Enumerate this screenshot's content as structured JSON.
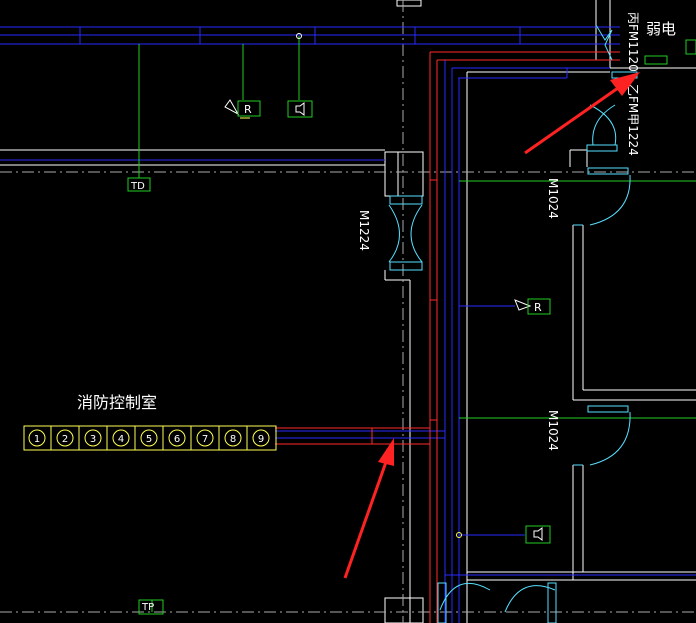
{
  "colors": {
    "background": "#000000",
    "wall": "#FFFFFF",
    "blue_pipe": "#2A2AFF",
    "red_pipe": "#FF2A2A",
    "green_line": "#22CC22",
    "door": "#55E0FF",
    "device_yellow": "#FFFF55",
    "annotation_arrow": "#FF2222"
  },
  "labels": {
    "weak_current": "弱电",
    "door_fm1120": "丙FM1120",
    "door_fm1224": "乙FM甲1224",
    "door_m1224": "M1224",
    "door_m1024_upper": "M1024",
    "door_m1024_lower": "M1024",
    "fire_control_room": "消防控制室",
    "td_box": "TD",
    "tp_box": "TP",
    "r_symbol": "R"
  },
  "terminal_numbers": [
    "1",
    "2",
    "3",
    "4",
    "5",
    "6",
    "7",
    "8",
    "9"
  ],
  "icons": {
    "remote_reader": "R-device-icon",
    "speaker": "speaker-icon",
    "junction": "junction-dot-icon"
  }
}
